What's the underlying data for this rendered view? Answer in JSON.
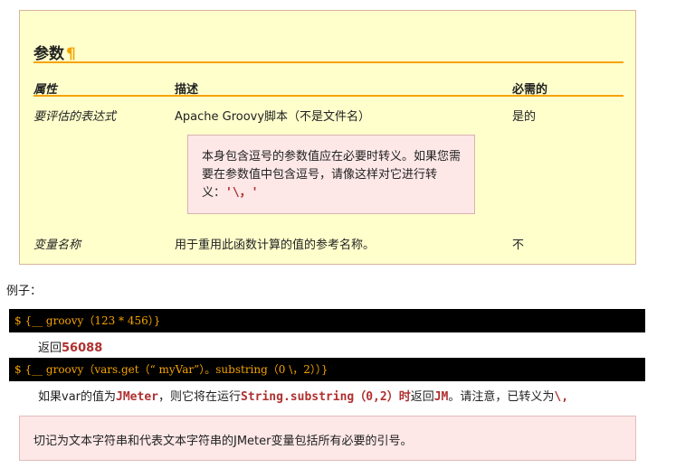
{
  "params": {
    "title": "参数",
    "pilcrow": "¶",
    "headers": {
      "attribute": "属性",
      "description": "描述",
      "required": "必需的"
    },
    "rows": [
      {
        "attribute": "要评估的表达式",
        "description": "Apache Groovy脚本（不是文件名）",
        "required": "是的"
      },
      {
        "attribute": "变量名称",
        "description": "用于重用此函数计算的值的参考名称。",
        "required": "不"
      }
    ],
    "note": {
      "text": "本身包含逗号的参数值应在必要时转义。如果您需要在参数值中包含逗号，请像这样对它进行转义：",
      "code": "'\\，'"
    }
  },
  "examples": {
    "label": "例子：",
    "code1": "$ {__ groovy（123 * 456）}",
    "result1_prefix": "返回",
    "result1_value": "56088",
    "code2": "$ {__ groovy（vars.get（“ myVar”）。substring（0 \\，2））}",
    "result2": {
      "p1": "如果var的值为",
      "v1": "JMeter",
      "p2": "，则它将在运行",
      "v2": "String.substring（0,2）时",
      "p3": "返回",
      "v3": "JM",
      "p4": "。请注意，已转义为",
      "v4": "\\,"
    }
  },
  "bottom_note": "切记为文本字符串和代表文本字符串的JMeter变量包括所有必要的引号。"
}
